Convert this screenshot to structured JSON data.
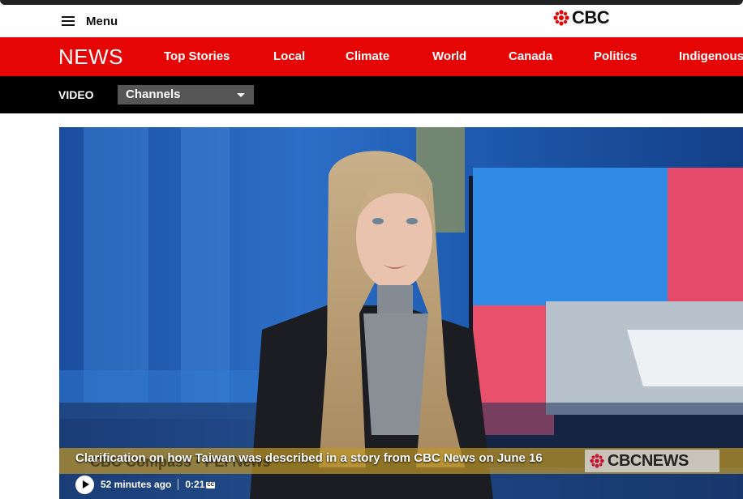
{
  "header": {
    "menu_label": "Menu",
    "brand": "CBC"
  },
  "nav": {
    "section_logo": "NEWS",
    "items": [
      "Top Stories",
      "Local",
      "Climate",
      "World",
      "Canada",
      "Politics",
      "Indigenous"
    ]
  },
  "subnav": {
    "video_label": "VIDEO",
    "channels_selected": "Channels"
  },
  "player": {
    "caption": "Clarification on how Taiwan was described in a story from CBC News on June 16",
    "ghost_lower_third": "CBC Compass  •  PEI News",
    "bug": "CBCNEWS",
    "time_ago": "52 minutes ago",
    "duration": "0:21",
    "cc": "CC"
  },
  "colors": {
    "brand_red": "#e60505",
    "subnav_black": "#000000",
    "dropdown_gray": "#555555"
  }
}
